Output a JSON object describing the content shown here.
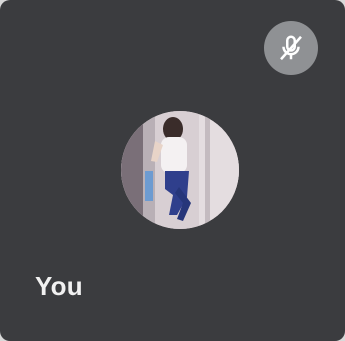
{
  "participant": {
    "name": "You",
    "status_icon": "microphone-muted-icon",
    "avatar": "user-avatar-photo"
  },
  "colors": {
    "tile_background": "#3b3c3f",
    "badge_background": "#8f9194",
    "label_text": "#f1f1f1"
  }
}
